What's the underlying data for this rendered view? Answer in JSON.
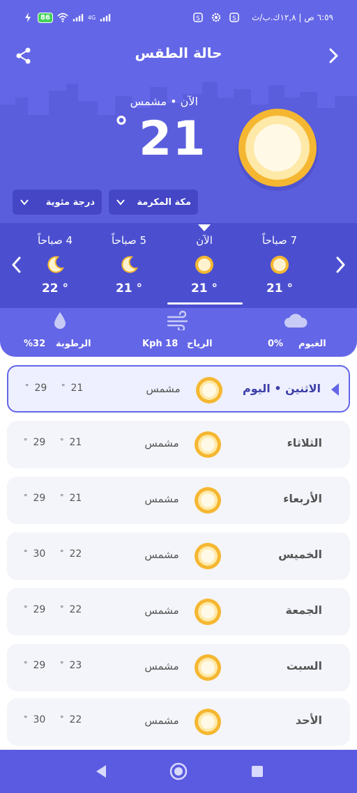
{
  "status_bar": {
    "time_text": "٦:٥٩ ص | ١٢,٨ك.ب/ث",
    "battery": "86",
    "network": "4G"
  },
  "header": {
    "title": "حالة الطقس"
  },
  "current": {
    "label": "الآن • مشمس",
    "temp": "21",
    "degree": "°",
    "location_dropdown": "مكة المكرمة",
    "unit_dropdown": "درجة مئوية"
  },
  "hourly": [
    {
      "label": "7 صباحاً",
      "icon": "sun-icon",
      "temp": "21 °"
    },
    {
      "label": "الآن",
      "icon": "sun-icon",
      "temp": "21 °"
    },
    {
      "label": "5 صباحاً",
      "icon": "moon-icon",
      "temp": "21 °"
    },
    {
      "label": "4 صباحاً",
      "icon": "moon-icon",
      "temp": "22 °"
    }
  ],
  "stats": {
    "clouds_label": "الغيوم",
    "clouds_value": "0%",
    "wind_label": "الرياح",
    "wind_value": "Kph 18",
    "humidity_label": "الرطوبة",
    "humidity_value": "%32"
  },
  "daily": [
    {
      "day": "الاثنين • اليوم",
      "condition": "مشمس",
      "high": "21",
      "low": "29",
      "selected": true
    },
    {
      "day": "الثلاثاء",
      "condition": "مشمس",
      "high": "21",
      "low": "29",
      "selected": false
    },
    {
      "day": "الأربعاء",
      "condition": "مشمس",
      "high": "21",
      "low": "29",
      "selected": false
    },
    {
      "day": "الخميس",
      "condition": "مشمس",
      "high": "22",
      "low": "30",
      "selected": false
    },
    {
      "day": "الجمعة",
      "condition": "مشمس",
      "high": "22",
      "low": "29",
      "selected": false
    },
    {
      "day": "السبت",
      "condition": "مشمس",
      "high": "23",
      "low": "29",
      "selected": false
    },
    {
      "day": "الأحد",
      "condition": "مشمس",
      "high": "22",
      "low": "30",
      "selected": false
    }
  ],
  "colors": {
    "primary": "#6366e6",
    "band": "#4b4fcf",
    "sun_ring": "#f5b731",
    "sun_core": "#fff6d8",
    "row_bg": "#f4f5fa",
    "navbar": "#5a5be0"
  }
}
